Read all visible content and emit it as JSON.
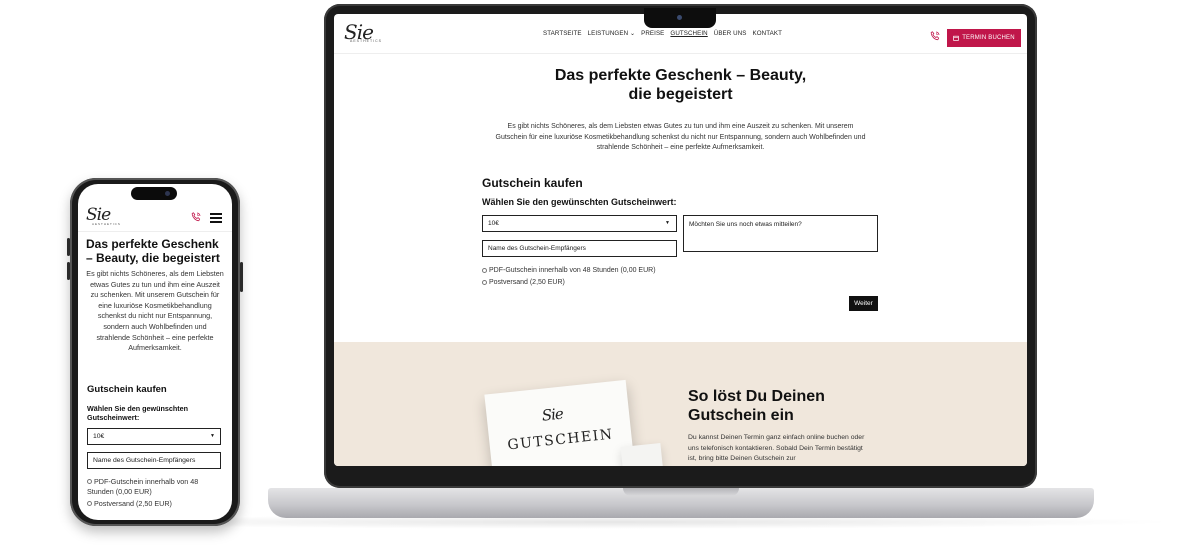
{
  "nav": {
    "logo_script": "Sie",
    "logo_sub": "AESTHETICS",
    "items": [
      "STARTSEITE",
      "LEISTUNGEN",
      "PREISE",
      "GUTSCHEIN",
      "ÜBER UNS",
      "KONTAKT"
    ],
    "active": "GUTSCHEIN",
    "book_button": "TERMIN BUCHEN"
  },
  "hero": {
    "title_line1": "Das perfekte Geschenk – Beauty,",
    "title_line2": "die begeistert",
    "mobile_title": "Das perfekte Geschenk – Beauty, die begeistert",
    "lead": "Es gibt nichts Schöneres, als dem Liebsten etwas Gutes zu tun und ihm eine Auszeit zu schenken. Mit unserem Gutschein für eine luxuriöse Kosmetikbehandlung schenkst du nicht nur Entspannung, sondern auch Wohlbefinden und strahlende Schönheit – eine perfekte Aufmerksamkeit."
  },
  "form": {
    "heading": "Gutschein kaufen",
    "value_label": "Wählen Sie den gewünschten Gutscheinwert:",
    "value_selected": "10€",
    "recipient_placeholder": "Name des Gutschein-Empfängers",
    "message_placeholder": "Möchten Sie uns noch etwas mitteilen?",
    "option_pdf": "PDF-Gutschein innerhalb von 48 Stunden (0,00 EUR)",
    "option_post": "Postversand (2,50 EUR)",
    "next_button": "Weiter"
  },
  "redeem": {
    "heading_line1": "So löst Du Deinen",
    "heading_line2": "Gutschein ein",
    "text": "Du kannst Deinen Termin ganz einfach online buchen oder uns telefonisch kontaktieren. Sobald Dein Termin bestätigt ist, bring bitte Deinen Gutschein zur",
    "card_text": "GUTSCHEIN"
  },
  "colors": {
    "accent": "#c0164a",
    "beige": "#f0e7dc",
    "dark": "#111111"
  },
  "icons": {
    "phone": "phone-icon",
    "calendar": "calendar-icon",
    "menu": "hamburger-menu-icon",
    "chevron": "chevron-down-icon"
  }
}
